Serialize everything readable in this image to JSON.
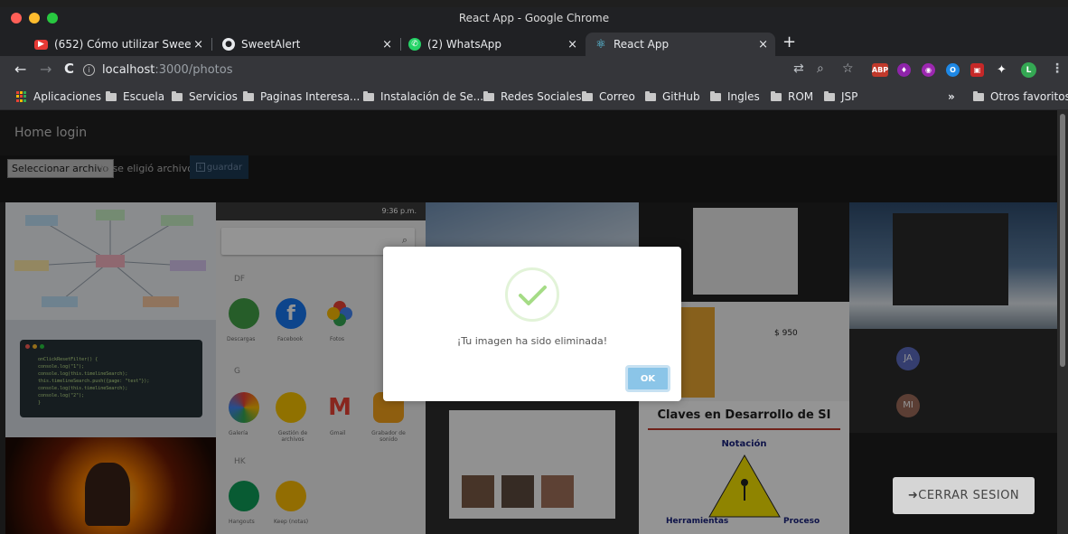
{
  "window": {
    "title": "React App - Google Chrome"
  },
  "tabs": [
    {
      "title": "(652) Cómo utilizar SweetAler",
      "close": "×",
      "favicon_color": "#e53935"
    },
    {
      "title": "SweetAlert",
      "close": "×",
      "favicon_color": "#ffffff"
    },
    {
      "title": "(2) WhatsApp",
      "close": "×",
      "favicon_color": "#25d366"
    },
    {
      "title": "React App",
      "close": "×",
      "favicon_color": "#61dafb"
    }
  ],
  "new_tab": "+",
  "toolbar": {
    "back": "←",
    "forward": "→",
    "reload": "C",
    "url_host": "localhost",
    "url_path": ":3000/photos",
    "info": "i",
    "translate": "⇄",
    "zoom": "⌕",
    "star": "☆",
    "profile_initial": "L",
    "menu": "⋮",
    "extensions": [
      {
        "label": "ABP",
        "color": "#c0392b"
      },
      {
        "label": "♦",
        "color": "#8e24aa"
      },
      {
        "label": "◉",
        "color": "#9c27b0"
      },
      {
        "label": "O",
        "color": "#1e88e5"
      },
      {
        "label": "▣",
        "color": "#c62828"
      },
      {
        "label": "✦",
        "color": "#5f6368"
      }
    ]
  },
  "bookmarks": {
    "items": [
      "Aplicaciones",
      "Escuela",
      "Servicios",
      "Paginas Interesa...",
      "Instalación de Se...",
      "Redes Sociales",
      "Correo",
      "GitHub",
      "Ingles",
      "ROM",
      "JSP"
    ],
    "more": "»",
    "other": "Otros favoritos"
  },
  "app": {
    "nav": {
      "home": "Home",
      "login": "login"
    },
    "upload": {
      "choose": "Seleccionar archivo",
      "no_file": "No se eligió archivo",
      "save": "guardar"
    },
    "phone_tile": {
      "time": "9:36 p.m.",
      "section_df": "DF",
      "section_g": "G",
      "section_hk": "HK",
      "apps": [
        "Descargas",
        "Facebook",
        "Fotos",
        "Galería",
        "Gestión de archivos",
        "Gmail",
        "Grabador de sonido",
        "Hangouts",
        "Keep (notas)"
      ]
    },
    "code_tile": {
      "lines": [
        "onClickResetFilter() {",
        "  console.log(\"1\");",
        "  console.log(this.timelineSearch);",
        "  this.timelineSearch.push({page: \"test\"});",
        "  console.log(this.timelineSearch);",
        "  console.log(\"2\");",
        "}"
      ]
    },
    "slide_tile": {
      "title": "Claves en Desarrollo de SI",
      "notacion": "Notación",
      "herramientas": "Herramientas",
      "proceso": "Proceso"
    },
    "product_tile": {
      "price": "$ 950"
    },
    "call_tile": {
      "avatar1": "JA",
      "avatar2": "MI"
    },
    "logout": "CERRAR SESION",
    "logout_icon": "➜"
  },
  "alert": {
    "message": "¡Tu imagen ha sido eliminada!",
    "ok": "OK",
    "icon": "success-checkmark",
    "accent": "#a5dc86"
  }
}
